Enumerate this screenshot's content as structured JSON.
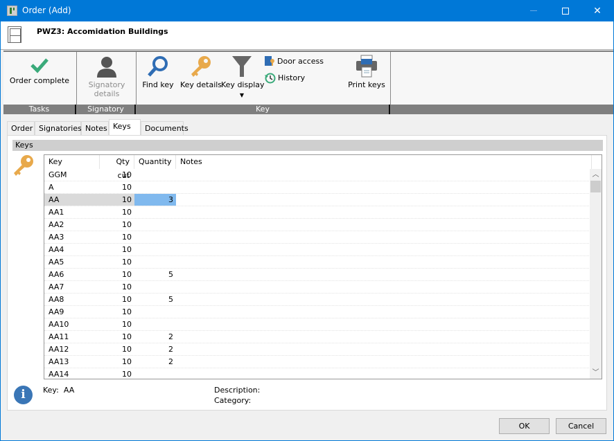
{
  "window": {
    "title": "Order (Add)",
    "controls": {
      "minimize": "minimize",
      "maximize": "maximize",
      "close": "close"
    }
  },
  "header": {
    "title": "PWZ3: Accomidation Buildings",
    "icon": "filing-cabinet-icon"
  },
  "ribbon": {
    "groups": [
      {
        "label": "Tasks"
      },
      {
        "label": "Signatory"
      },
      {
        "label": "Key"
      },
      {
        "label": ""
      }
    ],
    "buttons": {
      "order_complete": "Order complete",
      "signatory_details_line1": "Signatory",
      "signatory_details_line2": "details",
      "find_key": "Find key",
      "key_details": "Key details",
      "key_display": "Key display",
      "door_access": "Door access",
      "history": "History",
      "print_keys": "Print keys"
    }
  },
  "tabs": [
    {
      "label": "Order",
      "active": false
    },
    {
      "label": "Signatories",
      "active": false
    },
    {
      "label": "Notes",
      "active": false
    },
    {
      "label": "Keys",
      "active": true
    },
    {
      "label": "Documents",
      "active": false
    }
  ],
  "keys_section": {
    "title": "Keys",
    "columns": [
      "Key",
      "Qty cut",
      "Quantity",
      "Notes"
    ],
    "rows": [
      {
        "key": "GGM",
        "qty_cut": "10",
        "quantity": "",
        "notes": ""
      },
      {
        "key": "A",
        "qty_cut": "10",
        "quantity": "",
        "notes": ""
      },
      {
        "key": "AA",
        "qty_cut": "10",
        "quantity": "3",
        "notes": "",
        "selected": true
      },
      {
        "key": "AA1",
        "qty_cut": "10",
        "quantity": "",
        "notes": ""
      },
      {
        "key": "AA2",
        "qty_cut": "10",
        "quantity": "",
        "notes": ""
      },
      {
        "key": "AA3",
        "qty_cut": "10",
        "quantity": "",
        "notes": ""
      },
      {
        "key": "AA4",
        "qty_cut": "10",
        "quantity": "",
        "notes": ""
      },
      {
        "key": "AA5",
        "qty_cut": "10",
        "quantity": "",
        "notes": ""
      },
      {
        "key": "AA6",
        "qty_cut": "10",
        "quantity": "5",
        "notes": ""
      },
      {
        "key": "AA7",
        "qty_cut": "10",
        "quantity": "",
        "notes": ""
      },
      {
        "key": "AA8",
        "qty_cut": "10",
        "quantity": "5",
        "notes": ""
      },
      {
        "key": "AA9",
        "qty_cut": "10",
        "quantity": "",
        "notes": ""
      },
      {
        "key": "AA10",
        "qty_cut": "10",
        "quantity": "",
        "notes": ""
      },
      {
        "key": "AA11",
        "qty_cut": "10",
        "quantity": "2",
        "notes": ""
      },
      {
        "key": "AA12",
        "qty_cut": "10",
        "quantity": "2",
        "notes": ""
      },
      {
        "key": "AA13",
        "qty_cut": "10",
        "quantity": "2",
        "notes": ""
      },
      {
        "key": "AA14",
        "qty_cut": "10",
        "quantity": "",
        "notes": ""
      }
    ]
  },
  "info": {
    "key_label": "Key:",
    "key_value": "AA",
    "description_label": "Description:",
    "description_value": "",
    "category_label": "Category:",
    "category_value": ""
  },
  "dialog": {
    "ok": "OK",
    "cancel": "Cancel"
  },
  "colors": {
    "accent": "#0078d7",
    "selection": "#80b9ee",
    "key_icon": "#e8a94b",
    "check": "#3aaa7a"
  }
}
